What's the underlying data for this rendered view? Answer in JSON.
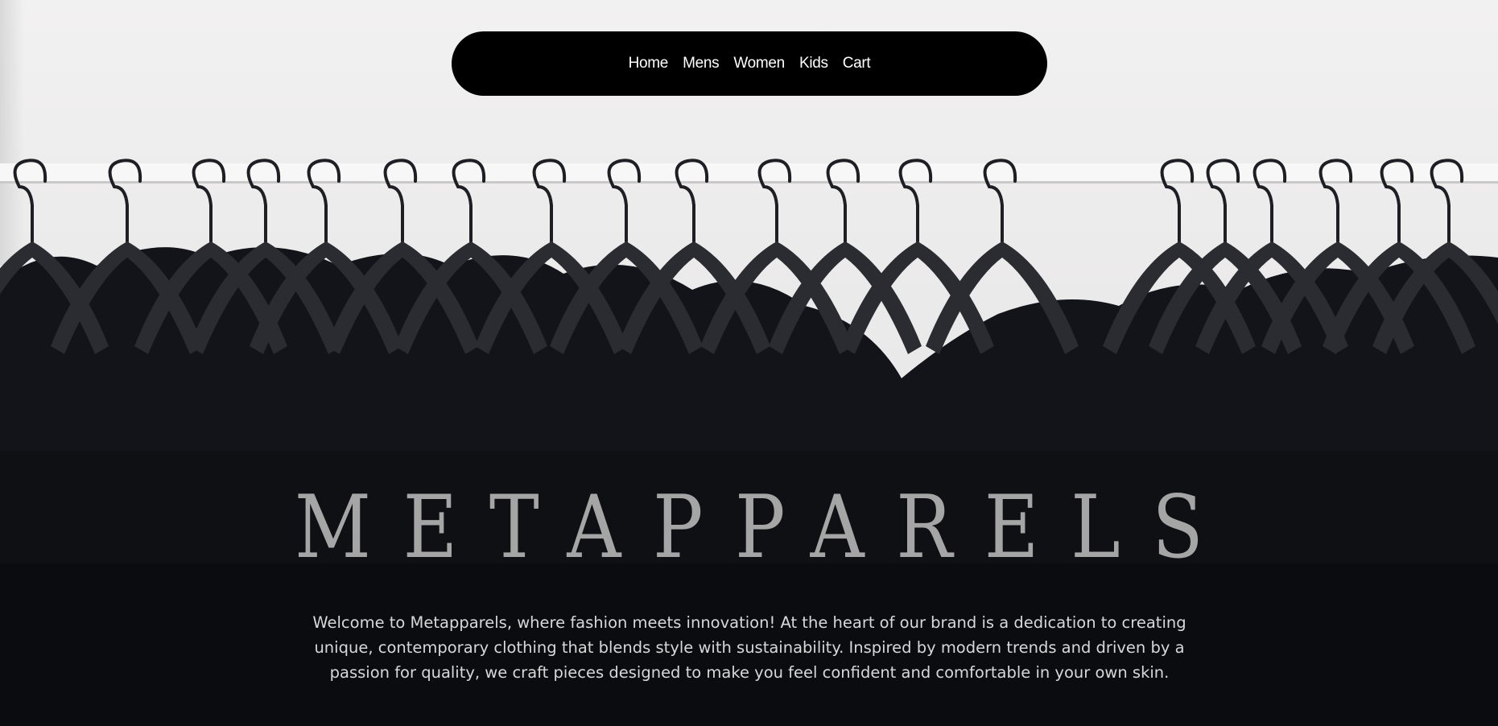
{
  "nav": {
    "items": [
      {
        "label": "Home"
      },
      {
        "label": "Mens"
      },
      {
        "label": "Women"
      },
      {
        "label": "Kids"
      },
      {
        "label": "Cart"
      }
    ]
  },
  "hero": {
    "title": "METAPPARELS",
    "description": "Welcome to Metapparels, where fashion meets innovation! At the heart of our brand is a dedication to creating unique, contemporary clothing that blends style with sustainability. Inspired by modern trends and driven by a passion for quality, we craft pieces designed to make you feel confident and comfortable in your own skin.",
    "image_subject": "black t-shirts on hangers on a white clothing rail"
  },
  "colors": {
    "navbar_bg": "#000000",
    "nav_text": "#ffffff",
    "title": "#a6a5a5",
    "description": "#d8d8d8",
    "garments": "#12141a",
    "wall": "#ecebeb"
  }
}
